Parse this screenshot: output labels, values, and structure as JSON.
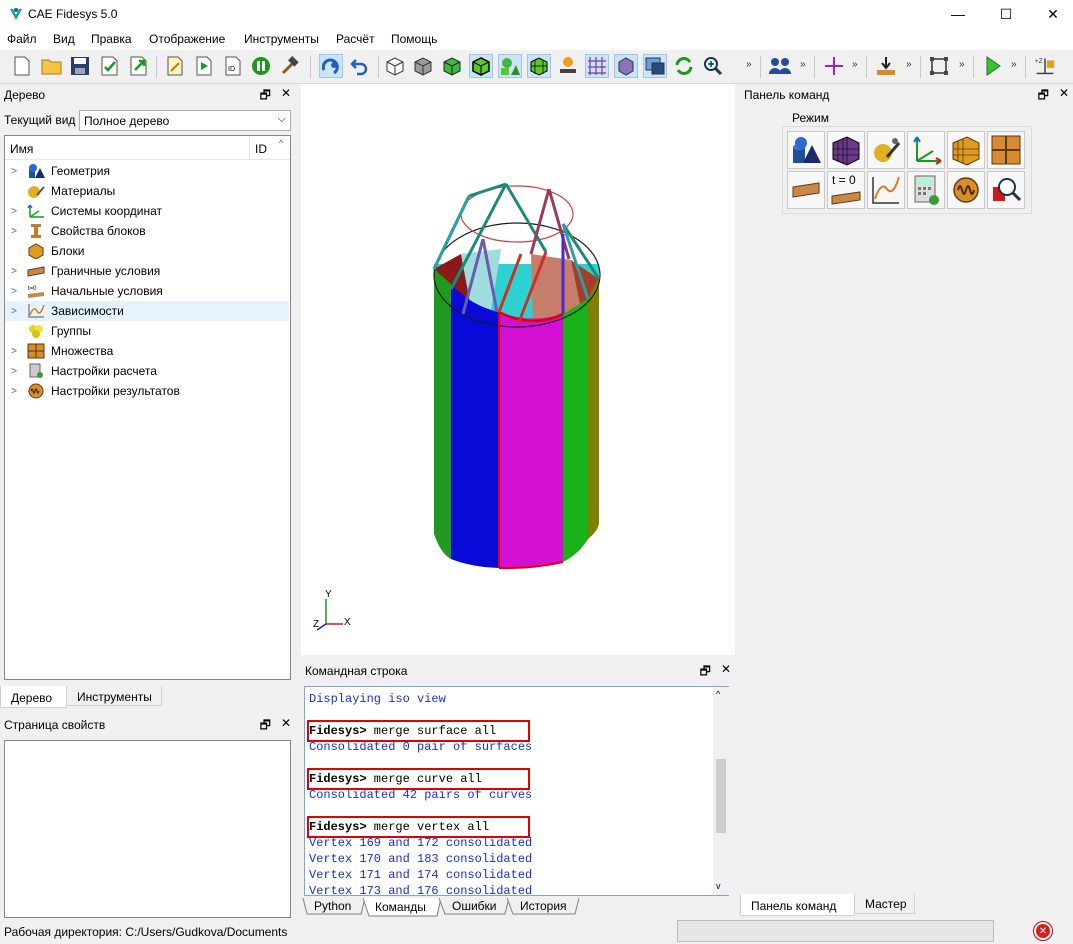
{
  "window": {
    "title": "CAE Fidesys 5.0",
    "controls": [
      "—",
      "☐",
      "✕"
    ]
  },
  "menu": [
    "Файл",
    "Вид",
    "Правка",
    "Отображение",
    "Инструменты",
    "Расчёт",
    "Помощь"
  ],
  "toolbar": {
    "more": "»"
  },
  "tree_panel": {
    "title": "Дерево",
    "view_label": "Текущий вид",
    "view_value": "Полное дерево",
    "col_name": "Имя",
    "col_id": "ID",
    "items": [
      {
        "label": "Геометрия",
        "icon": "geometry-icon",
        "expandable": true
      },
      {
        "label": "Материалы",
        "icon": "materials-icon",
        "expandable": false
      },
      {
        "label": "Системы координат",
        "icon": "coordinate-systems-icon",
        "expandable": true
      },
      {
        "label": "Свойства блоков",
        "icon": "block-properties-icon",
        "expandable": true
      },
      {
        "label": "Блоки",
        "icon": "blocks-icon",
        "expandable": false
      },
      {
        "label": "Граничные условия",
        "icon": "boundary-conditions-icon",
        "expandable": true
      },
      {
        "label": "Начальные условия",
        "icon": "initial-conditions-icon",
        "expandable": true
      },
      {
        "label": "Зависимости",
        "icon": "dependencies-icon",
        "expandable": true,
        "selected": true
      },
      {
        "label": "Группы",
        "icon": "groups-icon",
        "expandable": false
      },
      {
        "label": "Множества",
        "icon": "sets-icon",
        "expandable": true
      },
      {
        "label": "Настройки расчета",
        "icon": "calc-settings-icon",
        "expandable": true
      },
      {
        "label": "Настройки результатов",
        "icon": "results-settings-icon",
        "expandable": true
      }
    ],
    "tabs": [
      "Дерево",
      "Инструменты"
    ]
  },
  "properties_panel": {
    "title": "Страница свойств"
  },
  "viewport": {
    "axis_y": "Y",
    "axis_x": "X",
    "axis_z": "Z"
  },
  "command_panel": {
    "title": "Командная строка",
    "lines": [
      {
        "text": "Displaying iso view",
        "kind": "output"
      },
      {
        "text": "",
        "kind": "blank"
      },
      {
        "prompt": "Fidesys>",
        "text": " merge surface all",
        "kind": "command"
      },
      {
        "text": "Consolidated 0 pair of surfaces",
        "kind": "output"
      },
      {
        "text": "",
        "kind": "blank"
      },
      {
        "prompt": "Fidesys>",
        "text": " merge curve all",
        "kind": "command"
      },
      {
        "text": "Consolidated 42 pairs of curves",
        "kind": "output"
      },
      {
        "text": "",
        "kind": "blank"
      },
      {
        "prompt": "Fidesys>",
        "text": " merge vertex all",
        "kind": "command"
      },
      {
        "text": "Vertex 169 and 172 consolidated",
        "kind": "output"
      },
      {
        "text": "Vertex 170 and 183 consolidated",
        "kind": "output"
      },
      {
        "text": "Vertex 171 and 174 consolidated",
        "kind": "output"
      },
      {
        "text": "Vertex 173 and 176 consolidated",
        "kind": "output"
      }
    ],
    "tabs": [
      "Python",
      "Команды",
      "Ошибки",
      "История"
    ],
    "active_tab": "Команды"
  },
  "right_panel": {
    "title": "Панель команд",
    "mode_label": "Режим",
    "t0_label": "t = 0",
    "tabs": [
      "Панель команд",
      "Мастер"
    ]
  },
  "status": {
    "workdir": "Рабочая директория: C:/Users/Gudkova/Documents"
  },
  "colors": {
    "accent": "#1a2ed6",
    "highlight": "#e30000",
    "selection": "#e5f3ff"
  }
}
